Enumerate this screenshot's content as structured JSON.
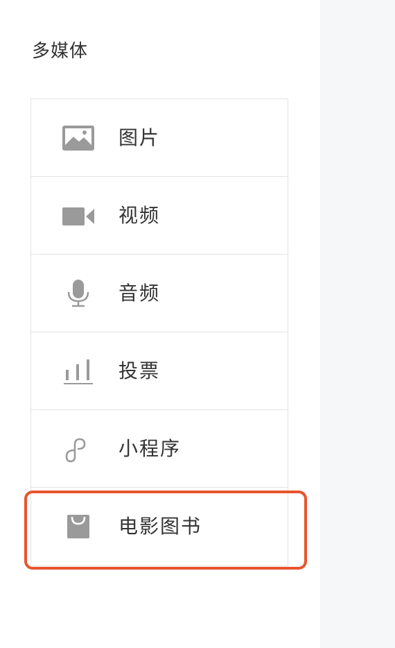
{
  "section": {
    "title": "多媒体"
  },
  "media_items": [
    {
      "label": "图片",
      "icon": "image-icon"
    },
    {
      "label": "视频",
      "icon": "video-camera-icon"
    },
    {
      "label": "音频",
      "icon": "microphone-icon"
    },
    {
      "label": "投票",
      "icon": "vote-chart-icon"
    },
    {
      "label": "小程序",
      "icon": "mini-program-icon"
    },
    {
      "label": "电影图书",
      "icon": "shopping-bag-icon"
    }
  ],
  "colors": {
    "icon_gray": "#9a9a9a",
    "text": "#333333",
    "border": "#e3e3e3",
    "highlight": "#e8552d",
    "right_panel_bg": "#f6f7f9"
  }
}
